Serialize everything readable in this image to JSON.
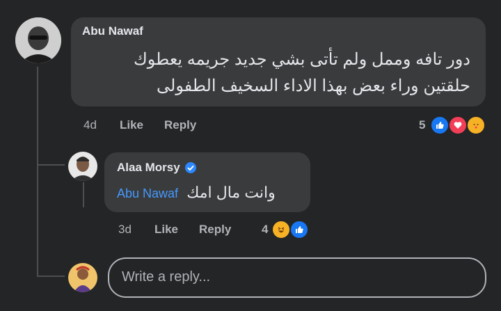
{
  "comment": {
    "author": "Abu Nawaf",
    "line1": "دور تافه وممل ولم تأتى بشي جديد  جريمه يعطوك",
    "line2": "حلقتين وراء بعض  بهذا الاداء السخيف الطفولى",
    "time": "4d",
    "like": "Like",
    "reply": "Reply",
    "reactions_count": "5"
  },
  "reply": {
    "author": "Alaa Morsy",
    "mention": "Abu Nawaf",
    "text": "وانت مال امك",
    "time": "3d",
    "like": "Like",
    "reply": "Reply",
    "reactions_count": "4"
  },
  "composer": {
    "placeholder": "Write a reply..."
  },
  "colors": {
    "bubble": "#3a3b3c",
    "mention": "#4599ff",
    "verified": "#2d88ff",
    "like_reaction": "#1877f2",
    "love_reaction": "#f33e58"
  }
}
